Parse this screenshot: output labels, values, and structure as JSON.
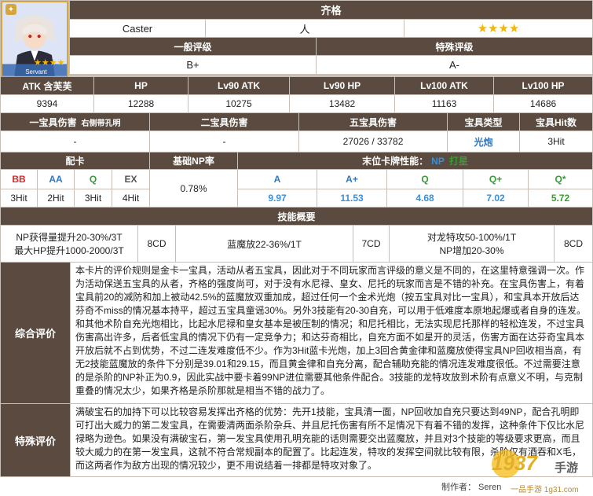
{
  "name": "齐格",
  "servant_class": "Caster",
  "attribute": "人",
  "rarity_stars": "★★★★",
  "portrait": {
    "label": "Servant",
    "stars": "★★★★"
  },
  "ratings": {
    "general_header": "一般评级",
    "general_value": "B+",
    "special_header": "特殊评级",
    "special_value": "A-"
  },
  "stats": {
    "headers": [
      "ATK 含芙芙",
      "HP",
      "Lv90 ATK",
      "Lv90 HP",
      "Lv100 ATK",
      "Lv100 HP"
    ],
    "values": [
      "9394",
      "12288",
      "10275",
      "13482",
      "11163",
      "14686"
    ]
  },
  "np": {
    "h1": "一宝具伤害",
    "h1_note": "右侧带孔明",
    "h2": "二宝具伤害",
    "h3": "五宝具伤害",
    "h4": "宝具类型",
    "h5": "宝具Hit数",
    "v1": "-",
    "v2": "-",
    "v3": "27026 / 33782",
    "v4": "光炮",
    "v5": "3Hit"
  },
  "cards": {
    "deck_header": "配卡",
    "np_header": "基础NP率",
    "end_header_prefix": "末位卡牌性能：",
    "end_header_np": "NP",
    "end_header_suffix": "打星",
    "card_labels": [
      "BB",
      "AA",
      "Q",
      "EX"
    ],
    "card_hits": [
      "3Hit",
      "2Hit",
      "3Hit",
      "4Hit"
    ],
    "np_rate": "0.78%",
    "perf_labels": [
      "A",
      "A+",
      "Q",
      "Q+",
      "Q*"
    ],
    "perf_np": [
      "9.97",
      "11.53",
      "4.68",
      "7.02",
      ""
    ],
    "perf_star": [
      "",
      "",
      "",
      "",
      "5.72"
    ]
  },
  "skills": {
    "header": "技能概要",
    "s1_line1": "NP获得量提升20-30%/3T",
    "s1_line2": "最大HP提升1000-2000/3T",
    "s1_cd": "8CD",
    "s2": "蓝魔放22-36%/1T",
    "s2_cd": "7CD",
    "s3_line1": "对龙特攻50-100%/1T",
    "s3_line2": "NP增加20-30%",
    "s3_cd": "8CD"
  },
  "overall": {
    "label": "综合评价",
    "text": "本卡片的评价规则是金卡一宝具，活动从者五宝具，因此对于不同玩家而言评级的意义是不同的，在这里特意强调一次。作为活动保送五宝具的从者，齐格的强度尚可，对于没有水尼禄、皇女、尼托的玩家而言是不错的补充。在宝具伤害上，有着宝具前20的减防和加上被动42.5%的蓝魔放双重加成，超过任何一个金术光炮（按五宝具对比一宝具），和宝具本开放后达芬奇不miss的情况基本持平，超过五宝具童谣30%。另外3技能有20-30自充，可以用于低难度本原地起爆或者自身的连发。和其他术阶自充光炮相比，比起水尼禄和皇女基本是被压制的情况；和尼托相比，无法实现尼托那样的轻松连发，不过宝具伤害高出许多，后者低宝具的情况下仍有一定竞争力；和达芬奇相比，自充方面不如星开的灵活，伤害方面在达芬奇宝具本开放后就不占到优势，不过二连发难度低不少。作为3Hit蓝卡光炮，加上3回合黄金律和蓝魔放使得宝具NP回收相当高，有无2技能蓝魔放的条件下分别是39.01和29.15，而且黄金律和自充分离，配合辅助充能的情况连发难度很低。不过需要注意的是杀阶的NP补正为0.9，因此实战中要卡着99NP进位需要其他条件配合。3技能的龙特攻放到术阶有点意义不明，与克制重叠的情况太少，如果齐格是杀阶那就是相当不错的战力了。"
  },
  "special": {
    "label": "特殊评价",
    "text": "满破宝石的加持下可以比较容易发挥出齐格的优势：先开1技能，宝具清一面，NP回收加自充只要达到49NP，配合孔明即可打出大威力的第二发宝具，在需要清两面杀阶杂兵、并且尼托伤害有所不足情况下有着不错的发挥，这种条件下仅比水尼禄略为逊色。如果没有满破宝石，第一发宝具使用孔明充能的话则需要交出蓝魔放，并且对3个技能的等级要求更高，而且较大威力的在第一发宝具，这就不符合常规副本的配置了。比起连发，特攻的发挥空间就比较有限，杀阶仅有酒吞和X毛，而这两者作为敌方出现的情况较少，更不用说结着一排都是特攻对象了。"
  },
  "footer": {
    "author": "制作者： Seren",
    "site": "一品手游 1g31.com"
  },
  "watermark": {
    "big": "1937",
    "small": "手游"
  }
}
